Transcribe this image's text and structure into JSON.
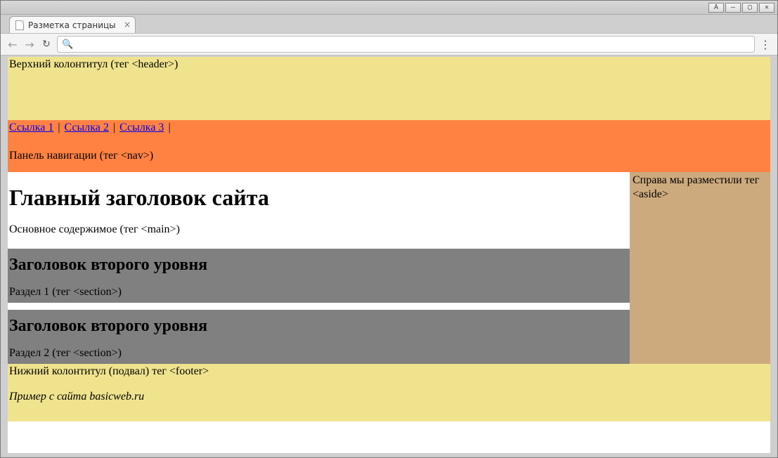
{
  "browser": {
    "tab_title": "Разметка страницы",
    "address_value": ""
  },
  "header": {
    "text": "Верхний колонтитул (тег <header>)"
  },
  "nav": {
    "links": [
      "Ссылка 1",
      "Ссылка 2",
      "Ссылка 3"
    ],
    "separator": "|",
    "caption": "Панель навигации (тег <nav>)"
  },
  "aside": {
    "text": "Справа мы разместили тег <aside>"
  },
  "main": {
    "h1": "Главный заголовок сайта",
    "caption": "Основное содержимое (тег <main>)",
    "sections": [
      {
        "h2": "Заголовок второго уровня",
        "caption": "Раздел 1 (тег <section>)"
      },
      {
        "h2": "Заголовок второго уровня",
        "caption": "Раздел 2 (тег <section>)"
      }
    ]
  },
  "footer": {
    "text": "Нижний колонтитул (подвал) тег <footer>",
    "source": "Пример с сайта basicweb.ru"
  },
  "colors": {
    "header_bg": "#f0e38e",
    "nav_bg": "#ff8243",
    "aside_bg": "#cdaa7d",
    "section_bg": "#808080"
  }
}
